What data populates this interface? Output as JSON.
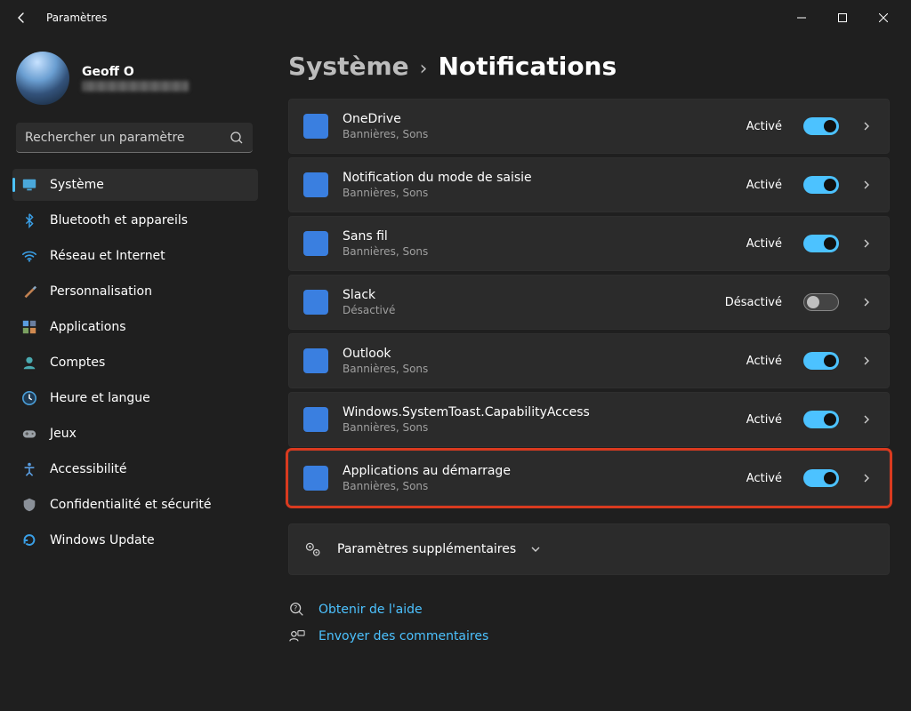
{
  "window": {
    "title": "Paramètres"
  },
  "profile": {
    "name": "Geoff O"
  },
  "search": {
    "placeholder": "Rechercher un paramètre"
  },
  "sidebar": {
    "items": [
      {
        "label": "Système",
        "icon": "monitor",
        "active": true
      },
      {
        "label": "Bluetooth et appareils",
        "icon": "bluetooth"
      },
      {
        "label": "Réseau et Internet",
        "icon": "wifi"
      },
      {
        "label": "Personnalisation",
        "icon": "brush"
      },
      {
        "label": "Applications",
        "icon": "apps"
      },
      {
        "label": "Comptes",
        "icon": "account"
      },
      {
        "label": "Heure et langue",
        "icon": "clock"
      },
      {
        "label": "Jeux",
        "icon": "gamepad"
      },
      {
        "label": "Accessibilité",
        "icon": "accessibility"
      },
      {
        "label": "Confidentialité et sécurité",
        "icon": "shield"
      },
      {
        "label": "Windows Update",
        "icon": "update"
      }
    ]
  },
  "breadcrumb": {
    "parent": "Système",
    "current": "Notifications"
  },
  "apps": [
    {
      "title": "OneDrive",
      "subtitle": "Bannières, Sons",
      "state": "Activé",
      "on": true,
      "iconClass": "ic-white"
    },
    {
      "title": "Notification du mode de saisie",
      "subtitle": "Bannières, Sons",
      "state": "Activé",
      "on": true,
      "iconClass": "ic-blue"
    },
    {
      "title": "Sans fil",
      "subtitle": "Bannières, Sons",
      "state": "Activé",
      "on": true,
      "iconClass": "ic-bluebox"
    },
    {
      "title": "Slack",
      "subtitle": "Désactivé",
      "state": "Désactivé",
      "on": false,
      "iconClass": "ic-bluebox"
    },
    {
      "title": "Outlook",
      "subtitle": "Bannières, Sons",
      "state": "Activé",
      "on": true,
      "iconClass": "ic-outlook"
    },
    {
      "title": "Windows.SystemToast.CapabilityAccess",
      "subtitle": "Bannières, Sons",
      "state": "Activé",
      "on": true,
      "iconClass": "ic-shield"
    },
    {
      "title": "Applications au démarrage",
      "subtitle": "Bannières, Sons",
      "state": "Activé",
      "on": true,
      "iconClass": "ic-grid",
      "highlight": true
    }
  ],
  "extra": {
    "label": "Paramètres supplémentaires"
  },
  "links": {
    "help": "Obtenir de l'aide",
    "feedback": "Envoyer des commentaires"
  }
}
